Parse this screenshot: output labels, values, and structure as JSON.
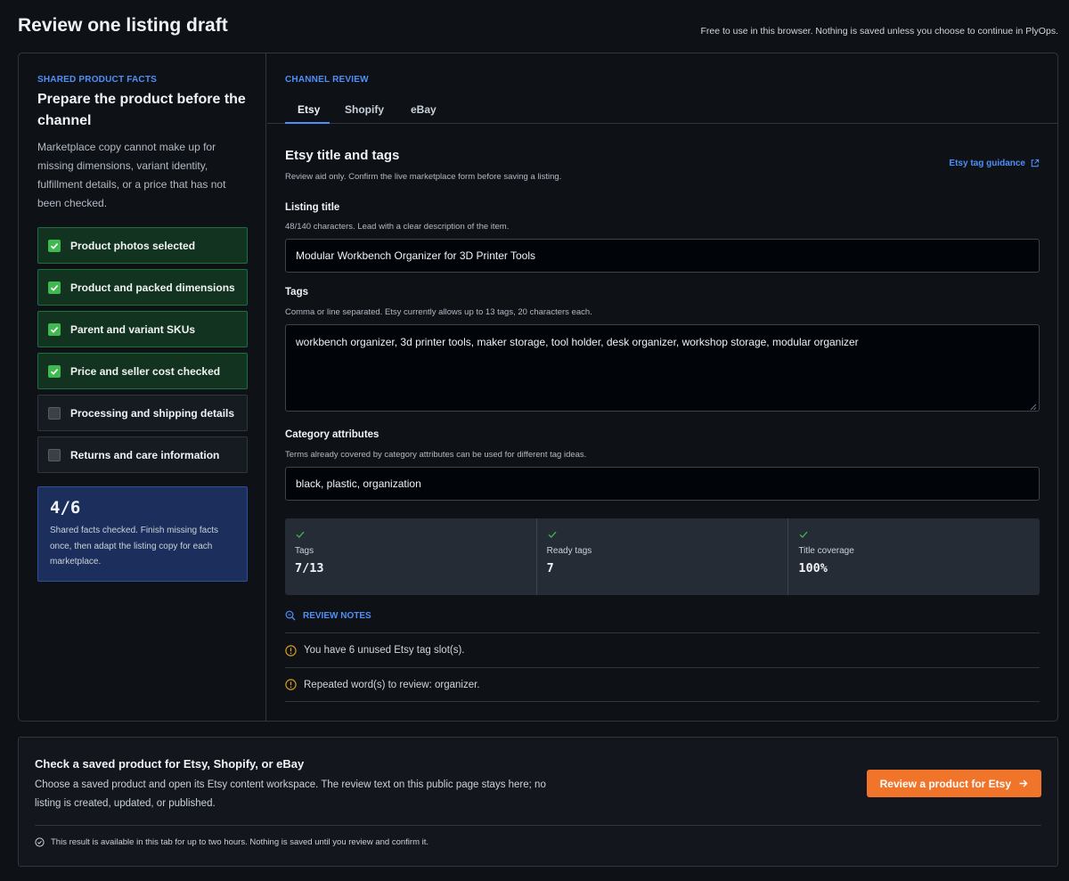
{
  "header": {
    "title": "Review one listing draft",
    "note": "Free to use in this browser. Nothing is saved unless you choose to continue in PlyOps."
  },
  "shared_facts": {
    "eyebrow": "SHARED PRODUCT FACTS",
    "heading": "Prepare the product before the channel",
    "description": "Marketplace copy cannot make up for missing dimensions, variant identity, fulfillment details, or a price that has not been checked.",
    "items": [
      {
        "label": "Product photos selected",
        "checked": true
      },
      {
        "label": "Product and packed dimensions",
        "checked": true
      },
      {
        "label": "Parent and variant SKUs",
        "checked": true
      },
      {
        "label": "Price and seller cost checked",
        "checked": true
      },
      {
        "label": "Processing and shipping details",
        "checked": false
      },
      {
        "label": "Returns and care information",
        "checked": false
      }
    ],
    "progress": {
      "value": "4/6",
      "text": "Shared facts checked. Finish missing facts once, then adapt the listing copy for each marketplace."
    }
  },
  "channel_review": {
    "eyebrow": "CHANNEL REVIEW",
    "tabs": [
      {
        "label": "Etsy",
        "active": true
      },
      {
        "label": "Shopify",
        "active": false
      },
      {
        "label": "eBay",
        "active": false
      }
    ],
    "section_title": "Etsy title and tags",
    "section_sub": "Review aid only. Confirm the live marketplace form before saving a listing.",
    "guide_link": "Etsy tag guidance",
    "listing_title": {
      "label": "Listing title",
      "help": "48/140 characters. Lead with a clear description of the item.",
      "value": "Modular Workbench Organizer for 3D Printer Tools"
    },
    "tags": {
      "label": "Tags",
      "help": "Comma or line separated. Etsy currently allows up to 13 tags, 20 characters each.",
      "value": "workbench organizer, 3d printer tools, maker storage, tool holder, desk organizer, workshop storage, modular organizer"
    },
    "category": {
      "label": "Category attributes",
      "help": "Terms already covered by category attributes can be used for different tag ideas.",
      "value": "black, plastic, organization"
    },
    "stats": [
      {
        "label": "Tags",
        "value": "7/13"
      },
      {
        "label": "Ready tags",
        "value": "7"
      },
      {
        "label": "Title coverage",
        "value": "100%"
      }
    ],
    "notes_heading": "REVIEW NOTES",
    "notes": [
      "You have 6 unused Etsy tag slot(s).",
      "Repeated word(s) to review: organizer."
    ]
  },
  "bottom": {
    "title": "Check a saved product for Etsy, Shopify, or eBay",
    "description": "Choose a saved product and open its Etsy content workspace. The review text on this public page stays here; no listing is created, updated, or published.",
    "cta": "Review a product for Etsy",
    "note": "This result is available in this tab for up to two hours. Nothing is saved until you review and confirm it."
  },
  "colors": {
    "accent": "#4f8ff7",
    "success": "#3fb950",
    "warning": "#d29922",
    "cta": "#f0742a"
  },
  "icons": [
    "check-icon",
    "external-link-icon",
    "search-zoom-icon",
    "warning-circle-icon",
    "arrow-right-icon",
    "clock-icon"
  ]
}
